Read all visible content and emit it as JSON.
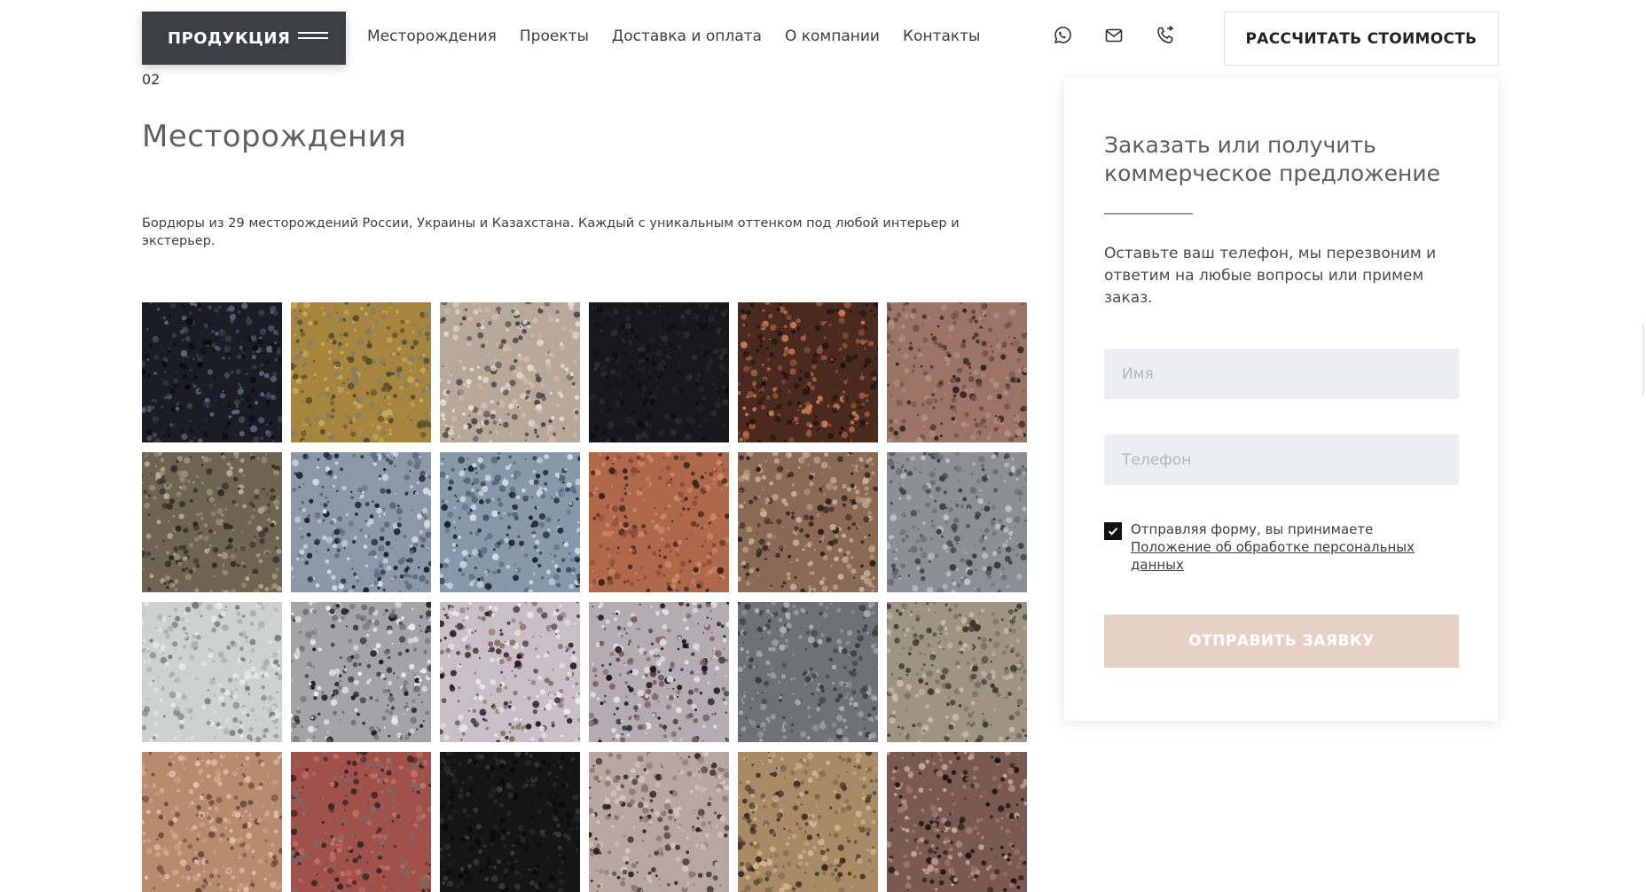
{
  "header": {
    "product_button": "ПРОДУКЦИЯ",
    "nav": [
      "Месторождения",
      "Проекты",
      "Доставка и оплата",
      "О компании",
      "Контакты"
    ],
    "icons": [
      "whatsapp-icon",
      "mail-icon",
      "phone-icon"
    ],
    "cta": "РАССЧИТАТЬ СТОИМОСТЬ"
  },
  "section": {
    "number": "02",
    "title": "Месторождения",
    "description": "Бордюры из 29 месторождений России, Украины и Казахстана. Каждый с уникальным оттенком под любой интерьер и экстерьер."
  },
  "stones": [
    {
      "base": "#1c1d24",
      "c1": "#3a4055",
      "c2": "#0a0a0e",
      "c3": "#5c6480"
    },
    {
      "base": "#a6863e",
      "c1": "#c9ac58",
      "c2": "#5a4a2a",
      "c3": "#7c7d70"
    },
    {
      "base": "#b8a89a",
      "c1": "#d4b9a8",
      "c2": "#4a4a4a",
      "c3": "#e6ddd3"
    },
    {
      "base": "#18181a",
      "c1": "#242426",
      "c2": "#0d0d0f",
      "c3": "#2e2e30"
    },
    {
      "base": "#4a2a1e",
      "c1": "#9a5a3e",
      "c2": "#1e1410",
      "c3": "#c47a52"
    },
    {
      "base": "#9b7466",
      "c1": "#b58c7c",
      "c2": "#2e2420",
      "c3": "#6a5048"
    },
    {
      "base": "#6e6452",
      "c1": "#9a8c74",
      "c2": "#2e2a24",
      "c3": "#b8ab92"
    },
    {
      "base": "#8a98a8",
      "c1": "#d6dde6",
      "c2": "#1c2230",
      "c3": "#5a6a80"
    },
    {
      "base": "#8798aa",
      "c1": "#d3dbe4",
      "c2": "#1a2230",
      "c3": "#56667c"
    },
    {
      "base": "#b0684a",
      "c1": "#d08a66",
      "c2": "#3a2620",
      "c3": "#8a4a36"
    },
    {
      "base": "#8a6a54",
      "c1": "#b89a80",
      "c2": "#2a221e",
      "c3": "#c9b29a"
    },
    {
      "base": "#8e8e96",
      "c1": "#c2c2ca",
      "c2": "#3a3a42",
      "c3": "#6a6a72"
    },
    {
      "base": "#cfd1d0",
      "c1": "#e9eae8",
      "c2": "#7a7c7c",
      "c3": "#aeb0b0"
    },
    {
      "base": "#a4a4a6",
      "c1": "#ececec",
      "c2": "#1e1e20",
      "c3": "#707072"
    },
    {
      "base": "#c8c0c6",
      "c1": "#eceaee",
      "c2": "#2a2020",
      "c3": "#8a6e64"
    },
    {
      "base": "#b3acb0",
      "c1": "#e6e2e6",
      "c2": "#1a1a1c",
      "c3": "#7c5a5a"
    },
    {
      "base": "#707078",
      "c1": "#9a9aa2",
      "c2": "#3a3a40",
      "c3": "#b0b0b6"
    },
    {
      "base": "#9e9482",
      "c1": "#c6bca6",
      "c2": "#3a3630",
      "c3": "#7a7060"
    },
    {
      "base": "#b88a6e",
      "c1": "#d0a486",
      "c2": "#6a4a3c",
      "c3": "#e0c0a8"
    },
    {
      "base": "#a0524a",
      "c1": "#c47066",
      "c2": "#3a2422",
      "c3": "#7a6a68"
    },
    {
      "base": "#151516",
      "c1": "#2a2a2c",
      "c2": "#0a0a0a",
      "c3": "#3a3a3c"
    },
    {
      "base": "#b8a6a0",
      "c1": "#d8c8c2",
      "c2": "#2a2222",
      "c3": "#8a7470"
    },
    {
      "base": "#a88a64",
      "c1": "#d0b48e",
      "c2": "#3a2e22",
      "c3": "#7a6650"
    },
    {
      "base": "#7a5a50",
      "c1": "#c6a89a",
      "c2": "#1e1614",
      "c3": "#a0786a"
    }
  ],
  "form": {
    "title": "Заказать или получить коммерческое предложение",
    "text": "Оставьте ваш телефон, мы перезвоним и ответим на любые вопросы или примем заказ.",
    "name_placeholder": "Имя",
    "phone_placeholder": "Телефон",
    "agree_text": "Отправляя форму, вы принимаете",
    "agree_link": "Положение об обработке персональных данных",
    "submit": "ОТПРАВИТЬ ЗАЯВКУ"
  }
}
